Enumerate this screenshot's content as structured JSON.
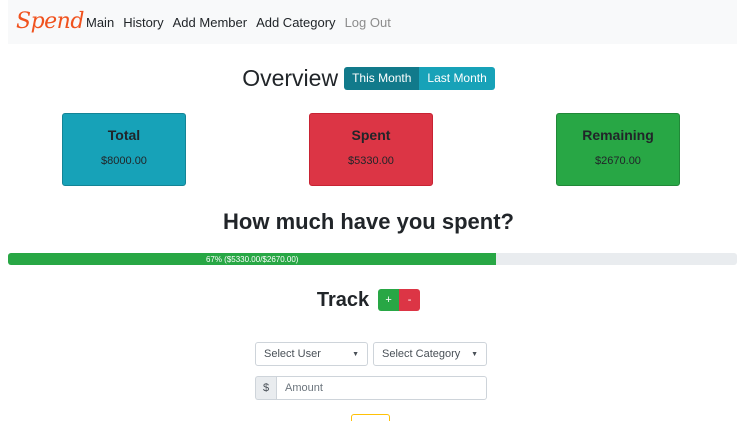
{
  "brand": {
    "name": "Spend",
    "color": "#f0521e"
  },
  "nav": {
    "items": [
      {
        "label": "Main"
      },
      {
        "label": "History"
      },
      {
        "label": "Add Member"
      },
      {
        "label": "Add Category"
      },
      {
        "label": "Log Out"
      }
    ]
  },
  "overview": {
    "title": "Overview",
    "tabs": [
      {
        "label": "This Month",
        "active": true
      },
      {
        "label": "Last Month",
        "active": false
      }
    ]
  },
  "cards": {
    "total": {
      "title": "Total",
      "value": "$8000.00",
      "color": "#17a2b8"
    },
    "spent": {
      "title": "Spent",
      "value": "$5330.00",
      "color": "#dc3545"
    },
    "remaining": {
      "title": "Remaining",
      "value": "$2670.00",
      "color": "#28a745"
    }
  },
  "spending": {
    "question": "How much have you spent?",
    "progress_percent": 67,
    "progress_label": "67% ($5330.00/$2670.00)"
  },
  "track": {
    "title": "Track",
    "add_label": "+",
    "remove_label": "-",
    "user_select": "Select User",
    "category_select": "Select Category",
    "currency_symbol": "$",
    "amount_placeholder": "Amount"
  }
}
